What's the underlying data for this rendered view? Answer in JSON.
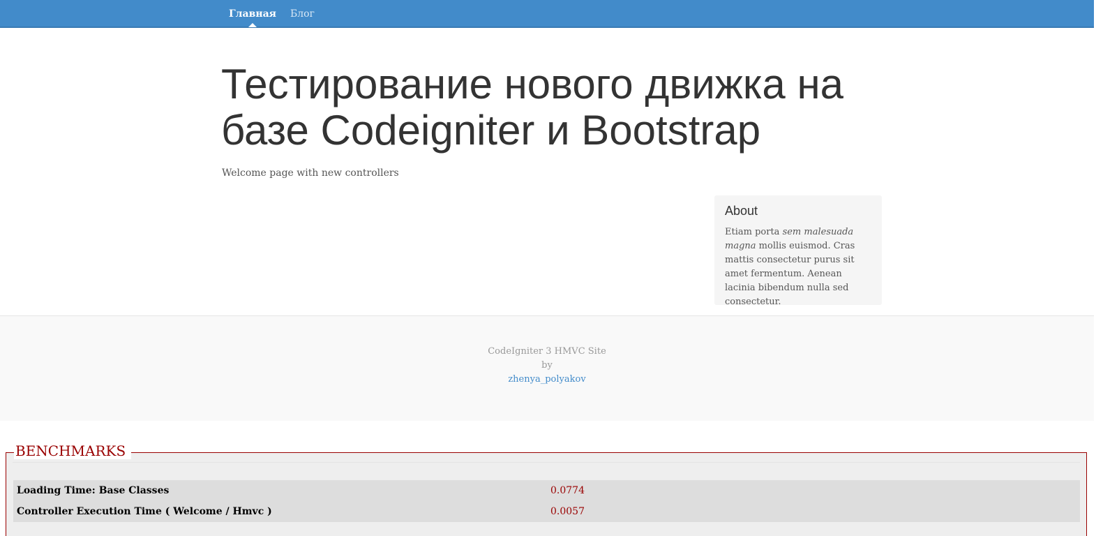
{
  "nav": {
    "items": [
      {
        "label": "Главная",
        "active": true
      },
      {
        "label": "Блог",
        "active": false
      }
    ]
  },
  "header": {
    "title": "Тестирование нового движка на базе Codeigniter и Bootstrap",
    "subtitle": "Welcome page with new controllers"
  },
  "sidebar": {
    "title": "About",
    "text_before": "Etiam porta ",
    "text_emphasis": "sem malesuada magna",
    "text_after": " mollis euismod. Cras mattis consectetur purus sit amet fermentum. Aenean lacinia bibendum nulla sed consectetur."
  },
  "footer": {
    "line1": "CodeIgniter 3 HMVC Site",
    "line2": "by",
    "author_link": "zhenya_polyakov"
  },
  "benchmarks": {
    "legend": "BENCHMARKS",
    "rows": [
      {
        "label": "Loading Time: Base Classes",
        "value": "0.0774"
      },
      {
        "label": "Controller Execution Time ( Welcome / Hmvc )",
        "value": "0.0057"
      }
    ]
  },
  "colors": {
    "navbar": "#428bca",
    "link": "#428bca",
    "benchmark_accent": "#990000"
  }
}
